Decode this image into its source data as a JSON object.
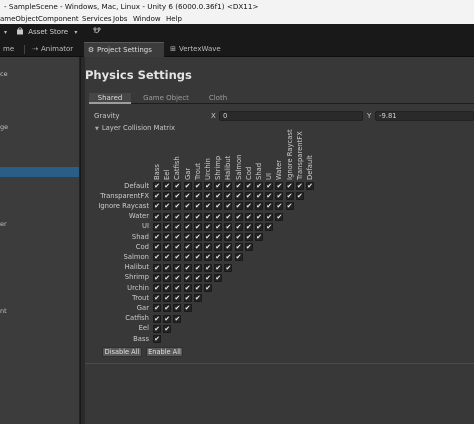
{
  "window": {
    "title": "- SampleScene - Windows, Mac, Linux - Unity 6 (6000.0.36f1) <DX11>"
  },
  "menu": [
    "ameObject",
    "Component",
    "Services",
    "Jobs",
    "Window",
    "Help"
  ],
  "toolbar": {
    "asset_store": "Asset Store"
  },
  "tabs": [
    {
      "label": "me",
      "icon": "scene-icon"
    },
    {
      "label": "Animator",
      "icon": "animator-icon"
    },
    {
      "label": "Project Settings",
      "icon": "gear-icon",
      "active": true
    },
    {
      "label": "VertexWave",
      "icon": "grid-icon"
    }
  ],
  "sidebar": {
    "items": [
      {
        "label": "ce"
      },
      {
        "label": "ge"
      },
      {
        "label": "",
        "active": true
      },
      {
        "label": "er"
      },
      {
        "label": "nt"
      }
    ]
  },
  "page": {
    "title": "Physics Settings"
  },
  "subtabs": [
    "Shared",
    "Game Object",
    "Cloth"
  ],
  "gravity": {
    "label": "Gravity",
    "x_label": "X",
    "x": "0",
    "y_label": "Y",
    "y": "-9.81"
  },
  "lcm": {
    "header": "Layer Collision Matrix",
    "layers": [
      "Default",
      "TransparentFX",
      "Ignore Raycast",
      "Water",
      "UI",
      "Shad",
      "Cod",
      "Salmon",
      "Halibut",
      "Shrimp",
      "Urchin",
      "Trout",
      "Gar",
      "Catfish",
      "Eel",
      "Bass"
    ],
    "column_order": [
      "Bass",
      "Eel",
      "Catfish",
      "Gar",
      "Trout",
      "Urchin",
      "Shrimp",
      "Halibut",
      "Salmon",
      "Cod",
      "Shad",
      "UI",
      "Water",
      "Ignore Raycast",
      "TransparentFX",
      "Default"
    ],
    "all_checked": true
  },
  "buttons": {
    "disable_all": "Disable All",
    "enable_all": "Enable All"
  }
}
